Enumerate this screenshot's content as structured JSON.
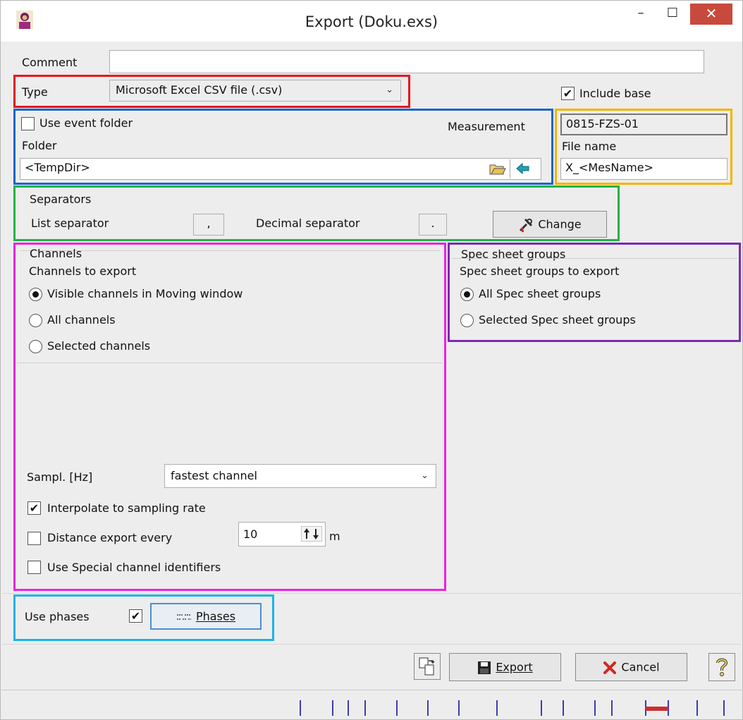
{
  "window": {
    "title": "Export (Doku.exs)",
    "minimize": "–",
    "maximize": "☐",
    "close": "✕"
  },
  "comment": {
    "label": "Comment",
    "value": ""
  },
  "type": {
    "label": "Type",
    "value": "Microsoft Excel CSV file (.csv)"
  },
  "include_base": {
    "label": "Include base",
    "checked": true
  },
  "folder": {
    "use_event_folder_label": "Use event folder",
    "use_event_folder_checked": false,
    "measurement_label": "Measurement",
    "folder_label": "Folder",
    "folder_value": "<TempDir>"
  },
  "measurement": {
    "value": "0815-FZS-01",
    "file_name_label": "File name",
    "file_name_value": "X_<MesName>"
  },
  "separators": {
    "title": "Separators",
    "list_label": "List separator",
    "list_value": ",",
    "decimal_label": "Decimal separator",
    "decimal_value": ".",
    "change_label": "Change"
  },
  "channels": {
    "title": "Channels",
    "subtitle": "Channels to export",
    "options": [
      {
        "label": "Visible channels in Moving window",
        "selected": true
      },
      {
        "label": "All channels",
        "selected": false
      },
      {
        "label": "Selected channels",
        "selected": false
      }
    ],
    "sampl_label": "Sampl. [Hz]",
    "sampl_value": "fastest channel",
    "interpolate_label": "Interpolate to sampling rate",
    "interpolate_checked": true,
    "distance_label": "Distance export every",
    "distance_checked": false,
    "distance_value": "10",
    "distance_unit": "m",
    "special_ids_label": "Use Special channel identifiers",
    "special_ids_checked": false
  },
  "spec_sheet": {
    "title": "Spec sheet groups",
    "subtitle": "Spec sheet groups to export",
    "options": [
      {
        "label": "All Spec sheet groups",
        "selected": true
      },
      {
        "label": "Selected Spec sheet groups",
        "selected": false
      }
    ]
  },
  "phases": {
    "label": "Use phases",
    "checked": true,
    "button_label": "Phases"
  },
  "footer": {
    "export_label": "Export",
    "cancel_label": "Cancel"
  },
  "colors": {
    "red_box": "#e8141e",
    "blue_box": "#1a64c8",
    "orange_box": "#f5b400",
    "green_box": "#1fb447",
    "magenta_box": "#ee22dd",
    "purple_box": "#7a2bb0",
    "cyan_box": "#1ab4e8"
  }
}
